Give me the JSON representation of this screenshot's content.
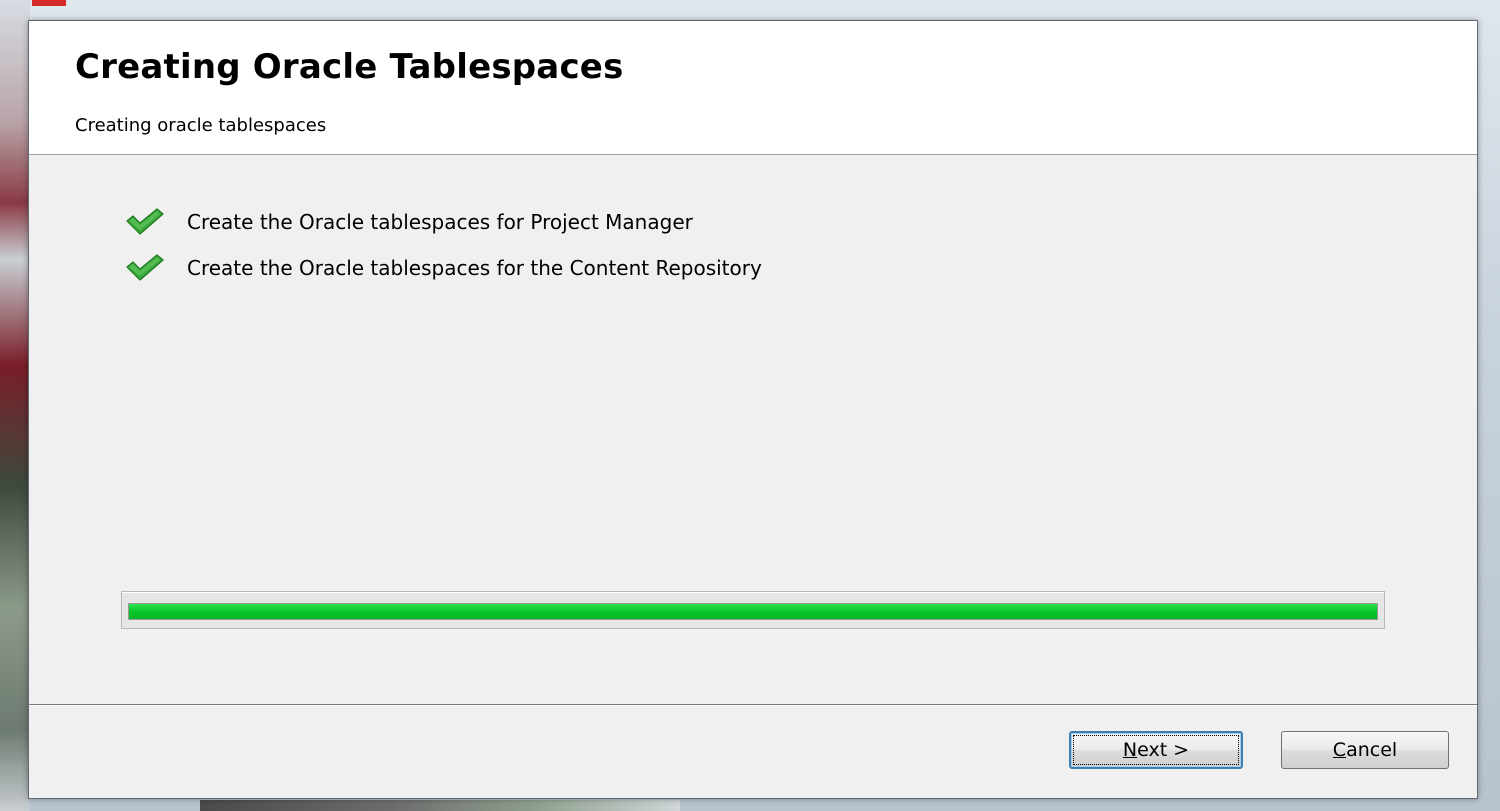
{
  "dialog": {
    "title": "Creating Oracle Tablespaces",
    "subtitle": "Creating oracle tablespaces"
  },
  "tasks": [
    {
      "label": "Create the Oracle tablespaces for Project Manager",
      "status": "complete",
      "icon": "checkmark-icon"
    },
    {
      "label": "Create the Oracle tablespaces for the Content Repository",
      "status": "complete",
      "icon": "checkmark-icon"
    }
  ],
  "progress": {
    "fraction": 1.0,
    "color": "#0ccf2e"
  },
  "buttons": {
    "next": {
      "mnemonic": "N",
      "rest": "ext >"
    },
    "cancel": {
      "mnemonic": "C",
      "rest": "ancel"
    }
  },
  "colors": {
    "check_green": "#2f9e2f",
    "progress_green": "#0ccf2e",
    "focus_border": "#3c7fb1"
  }
}
